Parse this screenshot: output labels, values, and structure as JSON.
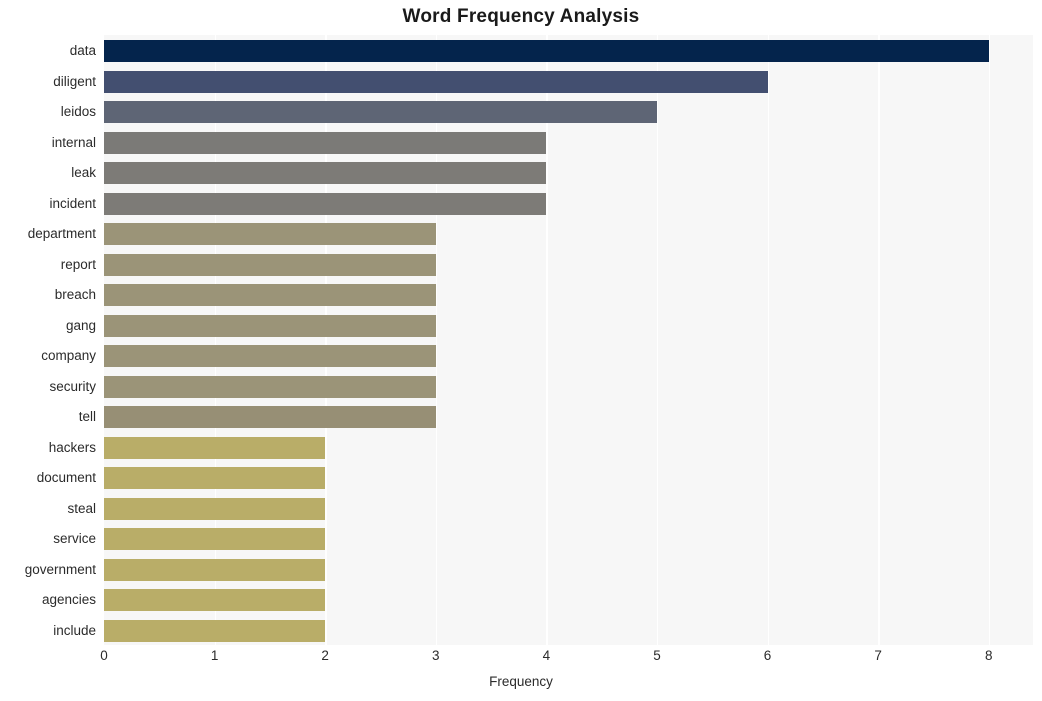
{
  "chart_data": {
    "type": "bar",
    "orientation": "horizontal",
    "title": "Word Frequency Analysis",
    "xlabel": "Frequency",
    "ylabel": "",
    "xlim": [
      0,
      8.4
    ],
    "ylim": [
      0,
      20
    ],
    "xticks": [
      0,
      1,
      2,
      3,
      4,
      5,
      6,
      7,
      8
    ],
    "grid": "vertical-white-on-light-gray",
    "legend": "none",
    "categories": [
      "data",
      "diligent",
      "leidos",
      "internal",
      "leak",
      "incident",
      "department",
      "report",
      "breach",
      "gang",
      "company",
      "security",
      "tell",
      "hackers",
      "document",
      "steal",
      "service",
      "government",
      "agencies",
      "include"
    ],
    "values": [
      8,
      6,
      5,
      4,
      4,
      4,
      3,
      3,
      3,
      3,
      3,
      3,
      3,
      2,
      2,
      2,
      2,
      2,
      2,
      2
    ],
    "bar_colors": [
      "#04244c",
      "#434f70",
      "#5e6575",
      "#7b7a77",
      "#7d7b77",
      "#7d7b77",
      "#9b9478",
      "#9b9478",
      "#9b9478",
      "#9b9478",
      "#9b9478",
      "#9b9478",
      "#978f75",
      "#b9ad68",
      "#b9ad68",
      "#b9ad68",
      "#b9ad68",
      "#b9ad68",
      "#b9ad68",
      "#b9ad68"
    ],
    "plot_background": "#f7f7f7",
    "figure_background": "#ffffff"
  }
}
